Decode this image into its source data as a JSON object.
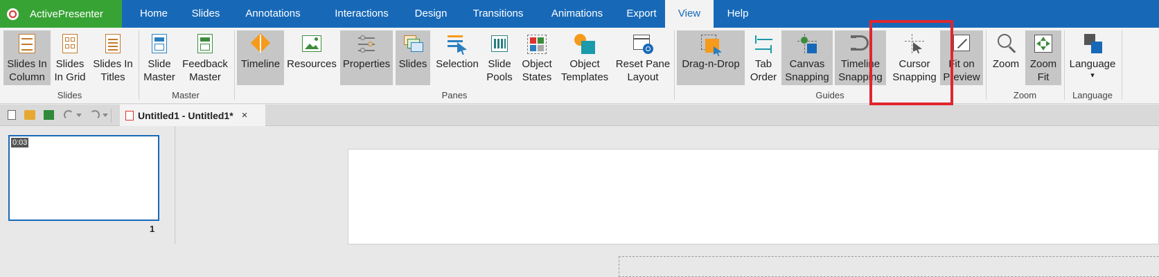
{
  "app": {
    "name": "ActivePresenter"
  },
  "menu": {
    "tabs": [
      "Home",
      "Slides",
      "Annotations",
      "Interactions",
      "Design",
      "Transitions",
      "Animations",
      "Export",
      "View",
      "Help"
    ],
    "active_tab": "View"
  },
  "ribbon": {
    "groups": {
      "slides": {
        "label": "Slides",
        "buttons": [
          {
            "label1": "Slides In",
            "label2": "Column",
            "selected": true
          },
          {
            "label1": "Slides",
            "label2": "In Grid",
            "selected": false
          },
          {
            "label1": "Slides In",
            "label2": "Titles",
            "selected": false
          }
        ]
      },
      "master": {
        "label": "Master",
        "buttons": [
          {
            "label1": "Slide",
            "label2": "Master"
          },
          {
            "label1": "Feedback",
            "label2": "Master"
          }
        ]
      },
      "panes": {
        "label": "Panes",
        "buttons": [
          {
            "label1": "Timeline",
            "label2": "",
            "selected": true
          },
          {
            "label1": "Resources",
            "label2": "",
            "selected": false
          },
          {
            "label1": "Properties",
            "label2": "",
            "selected": true
          },
          {
            "label1": "Slides",
            "label2": "",
            "selected": true
          },
          {
            "label1": "Selection",
            "label2": "",
            "selected": false
          },
          {
            "label1": "Slide",
            "label2": "Pools",
            "selected": false
          },
          {
            "label1": "Object",
            "label2": "States",
            "selected": false
          },
          {
            "label1": "Object",
            "label2": "Templates",
            "selected": false
          },
          {
            "label1": "Reset Pane",
            "label2": "Layout",
            "selected": false
          }
        ]
      },
      "guides": {
        "label": "Guides",
        "buttons": [
          {
            "label1": "Drag-n-Drop",
            "label2": "",
            "selected": true
          },
          {
            "label1": "Tab",
            "label2": "Order",
            "selected": false
          },
          {
            "label1": "Canvas",
            "label2": "Snapping",
            "selected": true
          },
          {
            "label1": "Timeline",
            "label2": "Snapping",
            "selected": true
          },
          {
            "label1": "Cursor",
            "label2": "Snapping",
            "selected": false
          },
          {
            "label1": "Fit on",
            "label2": "Preview",
            "selected": true
          }
        ]
      },
      "zoom": {
        "label": "Zoom",
        "buttons": [
          {
            "label1": "Zoom",
            "label2": "",
            "selected": false
          },
          {
            "label1": "Zoom",
            "label2": "Fit",
            "selected": true
          }
        ]
      },
      "language": {
        "label": "Language",
        "buttons": [
          {
            "label1": "Language",
            "label2": "▾"
          }
        ]
      }
    }
  },
  "document": {
    "tab_title": "Untitled1 - Untitled1*",
    "close_glyph": "×"
  },
  "slides_pane": {
    "thumbnail": {
      "duration": "0:03",
      "number": "1"
    }
  },
  "colors": {
    "menubar": "#1769b8",
    "app_button": "#38a335",
    "highlight": "#e0262e"
  }
}
